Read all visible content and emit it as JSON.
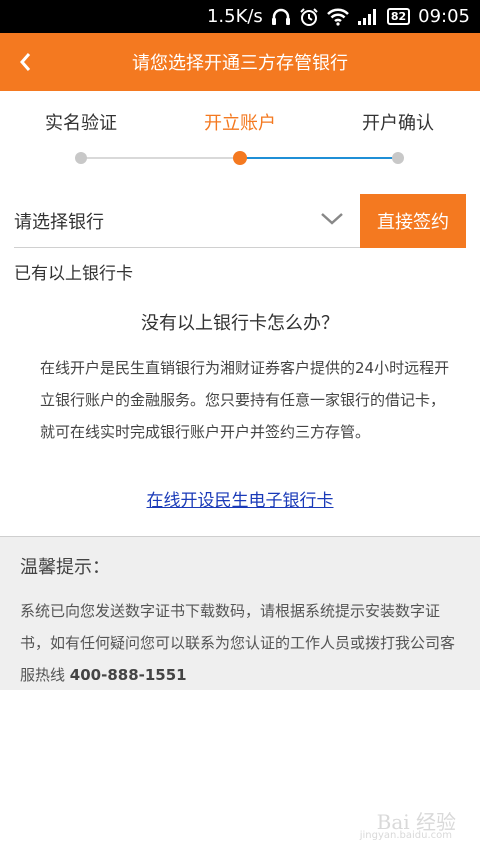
{
  "status_bar": {
    "net_speed": "1.5K/s",
    "battery": "82",
    "time": "09:05",
    "icons": [
      "headphones-icon",
      "alarm-icon",
      "wifi-icon",
      "signal-icon",
      "battery-icon"
    ]
  },
  "header": {
    "back_icon": "chevron-left-icon",
    "title": "请您选择开通三方存管银行"
  },
  "steps": {
    "items": [
      {
        "label": "实名验证",
        "state": "done"
      },
      {
        "label": "开立账户",
        "state": "active"
      },
      {
        "label": "开户确认",
        "state": "pending"
      }
    ],
    "active_color": "#f47920",
    "done_line_color": "#d9d9d9",
    "pending_line_color": "#1f8fd6"
  },
  "bank_select": {
    "placeholder": "请选择银行",
    "dropdown_icon": "chevron-down-icon",
    "sign_button": "直接签约"
  },
  "has_card_text": "已有以上银行卡",
  "faq": {
    "title": "没有以上银行卡怎么办？",
    "body": "在线开户是民生直销银行为湘财证券客户提供的24小时远程开立银行账户的金融服务。您只要持有任意一家银行的借记卡，就可在线实时完成银行账户开户并签约三方存管。",
    "link": "在线开设民生电子银行卡"
  },
  "tips": {
    "title": "温馨提示：",
    "body": "系统已向您发送数字证书下载数码，请根据系统提示安装数字证书，如有任何疑问您可以联系为您认证的工作人员或拨打我公司客服热线 ",
    "hotline": "400-888-1551"
  },
  "watermark": {
    "text": "Bai 经验",
    "sub": "jingyan.baidu.com"
  },
  "colors": {
    "brand": "#f47920",
    "link": "#1a3ab8"
  }
}
